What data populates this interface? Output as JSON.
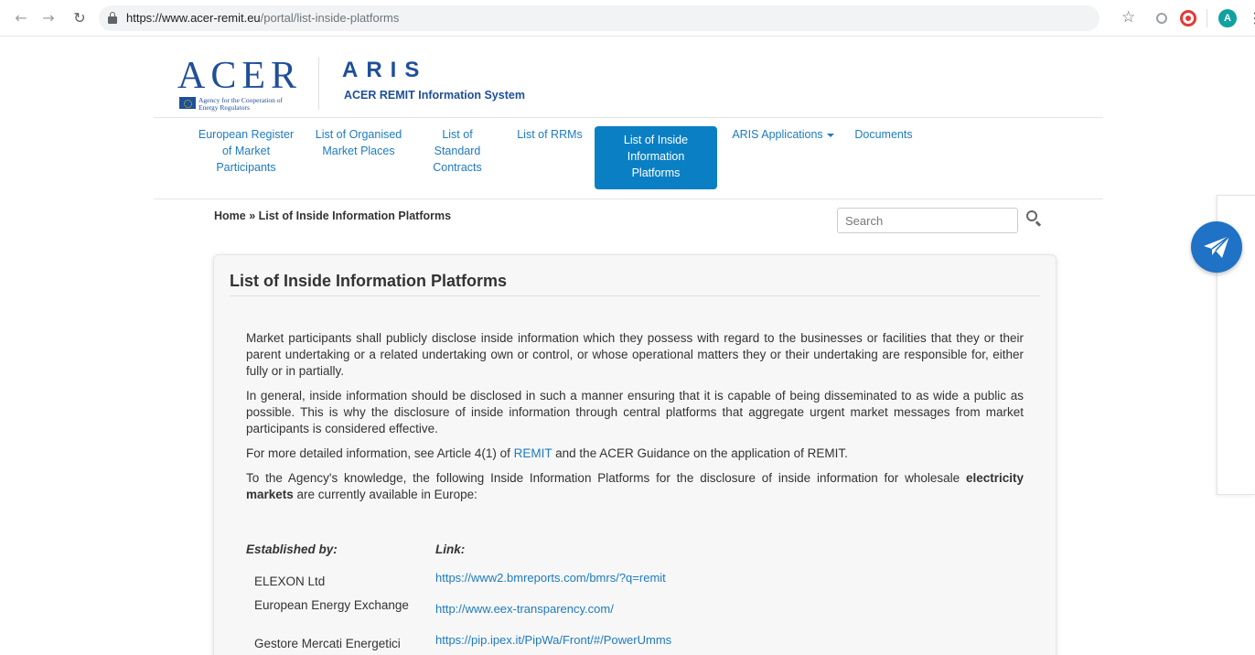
{
  "browser": {
    "url_host": "https://www.acer-remit.eu",
    "url_path": "/portal/list-inside-platforms",
    "avatar_letter": "A"
  },
  "header": {
    "acer_letters": "ACER",
    "acer_subtitle": "Agency for the Cooperation of Energy Regulators",
    "aris_letters": "ARIS",
    "aris_subtitle": "ACER REMIT Information System"
  },
  "nav": {
    "items": [
      {
        "label": "European Register of Market Participants"
      },
      {
        "label": "List of Organised Market Places"
      },
      {
        "label": "List of Standard Contracts"
      },
      {
        "label": "List of RRMs"
      },
      {
        "label": "List of Inside Information Platforms",
        "active": true
      },
      {
        "label": "ARIS Applications"
      },
      {
        "label": "Documents"
      }
    ]
  },
  "breadcrumb": "Home » List of Inside Information Platforms",
  "search": {
    "placeholder": "Search"
  },
  "panel": {
    "title": "List of Inside Information Platforms",
    "para1": "Market participants shall publicly disclose inside information which they possess with regard to the businesses or facilities that they or their parent undertaking or a related undertaking own or control, or whose operational matters they or their undertaking are responsible for, either fully or in partially.",
    "para2": "In general, inside information should be disclosed in such a manner ensuring that it is capable of being disseminated to as wide a public as possible. This is why the disclosure of inside information through central platforms that aggregate urgent market messages from market participants is considered effective.",
    "para3_before": "For more detailed information, see Article 4(1) of ",
    "para3_link": "REMIT",
    "para3_after": " and the ACER Guidance on the application of REMIT.",
    "para4_before": "To the Agency's knowledge, the following Inside Information Platforms for the disclosure of inside information for wholesale ",
    "para4_bold": "electricity markets",
    "para4_after": " are currently available in Europe:"
  },
  "table": {
    "col_established": "Established by:",
    "col_link": "Link:",
    "rows": [
      {
        "name": "ELEXON Ltd",
        "link": "https://www2.bmreports.com/bmrs/?q=remit"
      },
      {
        "name": "European Energy Exchange",
        "link": "http://www.eex-transparency.com/"
      },
      {
        "name": "Gestore Mercati Energetici",
        "link": "https://pip.ipex.it/PipWa/Front/#/PowerUmms"
      }
    ]
  }
}
